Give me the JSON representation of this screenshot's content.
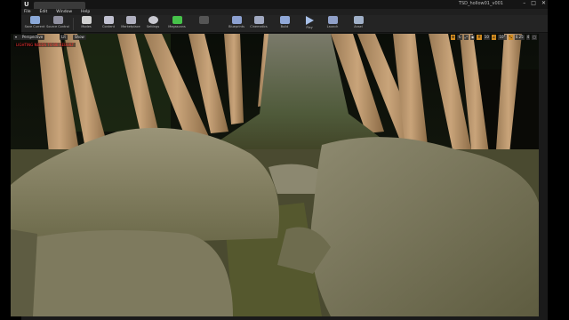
{
  "window": {
    "app_logo": "U",
    "project_name": "TSD_hollow01_v001",
    "controls": [
      "–",
      "□",
      "✕"
    ]
  },
  "menu": [
    "File",
    "Edit",
    "Window",
    "Help"
  ],
  "toolbar": [
    {
      "label": "Save Current",
      "icon": "save-icon",
      "color": "#8aa8d8"
    },
    {
      "label": "Source Control",
      "icon": "source-control-icon",
      "color": "#9090a0"
    },
    {
      "label": "Modes",
      "icon": "modes-icon",
      "color": "#d0d0d0"
    },
    {
      "label": "Content",
      "icon": "content-icon",
      "color": "#c0c0d0"
    },
    {
      "label": "Marketplace",
      "icon": "marketplace-icon",
      "color": "#b0b0c0"
    },
    {
      "label": "Settings",
      "icon": "settings-icon",
      "color": "#c8c8d0"
    },
    {
      "label": "Megascans",
      "icon": "megascans-icon",
      "color": "#46c24a"
    },
    {
      "label": "",
      "icon": "blank-icon",
      "color": "#555555"
    },
    {
      "label": "Blueprints",
      "icon": "blueprints-icon",
      "color": "#8ca0d0"
    },
    {
      "label": "Cinematics",
      "icon": "cinematics-icon",
      "color": "#a0a8c0"
    },
    {
      "label": "Build",
      "icon": "build-icon",
      "color": "#90a8d8"
    },
    {
      "label": "Play",
      "icon": "play-icon",
      "color": "#a8c0e8"
    },
    {
      "label": "Launch",
      "icon": "launch-icon",
      "color": "#90a0c8"
    },
    {
      "label": "Ansel",
      "icon": "ansel-icon",
      "color": "#a0b0c8"
    }
  ],
  "viewport": {
    "perspective_label": "Perspective",
    "lit_label": "Lit",
    "show_label": "Show",
    "warning": "LIGHTING NEEDS TO BE REBUILT",
    "snap_values": [
      "10",
      "10°",
      "0.25",
      "4"
    ]
  }
}
